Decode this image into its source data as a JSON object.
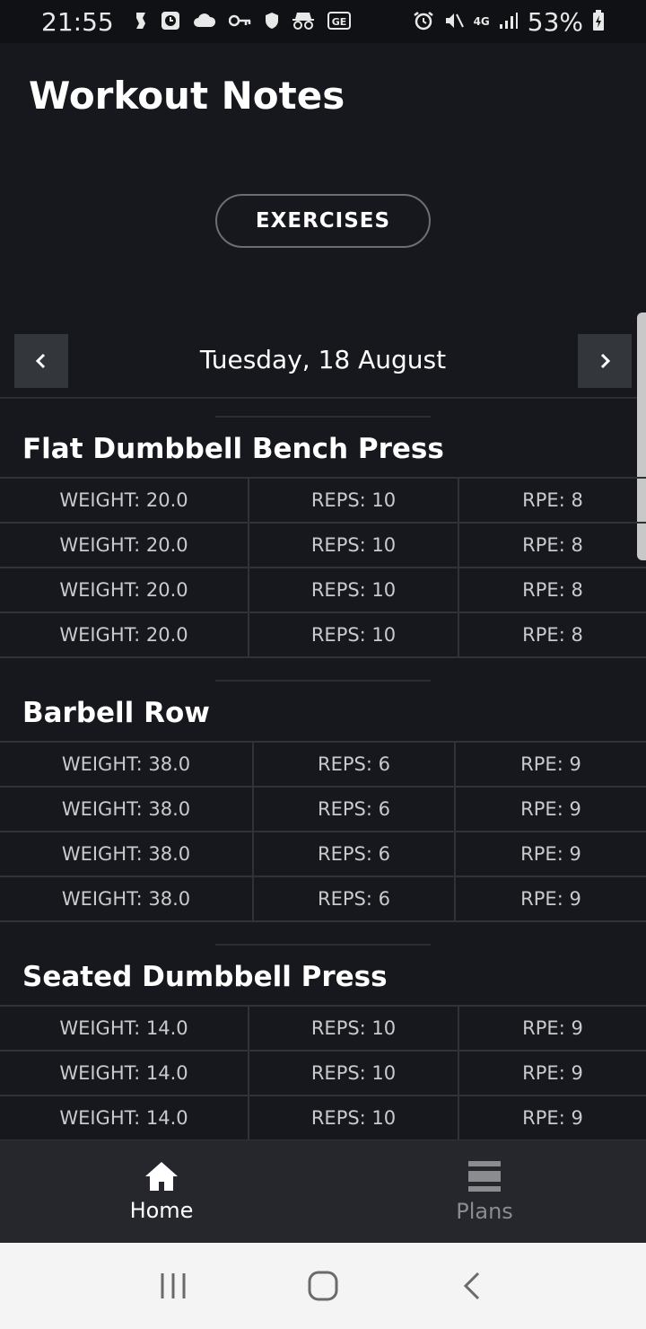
{
  "status_bar": {
    "time": "21:55",
    "network": "4G",
    "battery": "53%"
  },
  "header": {
    "title": "Workout Notes"
  },
  "exercises_button": {
    "label": "EXERCISES"
  },
  "date_nav": {
    "date": "Tuesday, 18  August"
  },
  "exercises": [
    {
      "name": "Flat Dumbbell Bench Press",
      "sets": [
        {
          "weight": "WEIGHT: 20.0",
          "reps": "REPS: 10",
          "rpe": "RPE: 8"
        },
        {
          "weight": "WEIGHT: 20.0",
          "reps": "REPS: 10",
          "rpe": "RPE: 8"
        },
        {
          "weight": "WEIGHT: 20.0",
          "reps": "REPS: 10",
          "rpe": "RPE: 8"
        },
        {
          "weight": "WEIGHT: 20.0",
          "reps": "REPS: 10",
          "rpe": "RPE: 8"
        }
      ]
    },
    {
      "name": "Barbell Row",
      "sets": [
        {
          "weight": "WEIGHT: 38.0",
          "reps": "REPS: 6",
          "rpe": "RPE: 9"
        },
        {
          "weight": "WEIGHT: 38.0",
          "reps": "REPS: 6",
          "rpe": "RPE: 9"
        },
        {
          "weight": "WEIGHT: 38.0",
          "reps": "REPS: 6",
          "rpe": "RPE: 9"
        },
        {
          "weight": "WEIGHT: 38.0",
          "reps": "REPS: 6",
          "rpe": "RPE: 9"
        }
      ]
    },
    {
      "name": "Seated Dumbbell Press",
      "sets": [
        {
          "weight": "WEIGHT: 14.0",
          "reps": "REPS: 10",
          "rpe": "RPE: 9"
        },
        {
          "weight": "WEIGHT: 14.0",
          "reps": "REPS: 10",
          "rpe": "RPE: 9"
        },
        {
          "weight": "WEIGHT: 14.0",
          "reps": "REPS: 10",
          "rpe": "RPE: 9"
        }
      ]
    }
  ],
  "bottom_nav": {
    "home": "Home",
    "plans": "Plans"
  }
}
